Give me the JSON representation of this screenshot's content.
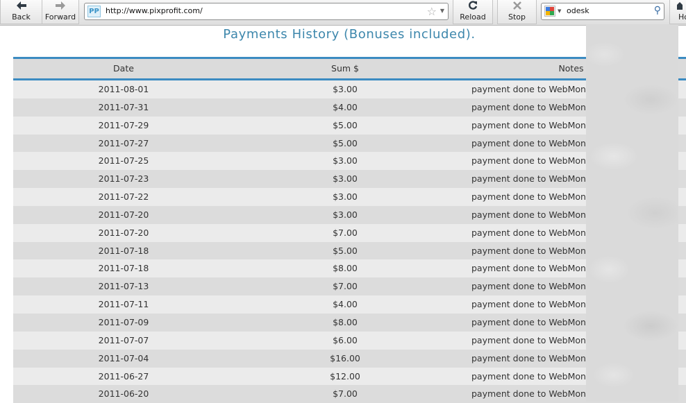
{
  "browser": {
    "back_label": "Back",
    "forward_label": "Forward",
    "reload_label": "Reload",
    "stop_label": "Stop",
    "home_label_partial": "Ho",
    "url": "http://www.pixprofit.com/",
    "site_icon_text": "PP",
    "search_query": "odesk",
    "icons": {
      "back": "arrow-left-icon",
      "forward": "arrow-right-icon",
      "reload": "reload-icon",
      "stop": "stop-x-icon",
      "bookmark": "star-icon",
      "search_engine": "google-icon",
      "search": "magnifier-icon"
    }
  },
  "page": {
    "title": "Payments History (Bonuses included).",
    "accent_color": "#3b8bc1",
    "title_color": "#3d87ac"
  },
  "table": {
    "headers": {
      "date": "Date",
      "sum": "Sum $",
      "notes": "Notes"
    },
    "rows": [
      {
        "date": "2011-08-01",
        "sum": "$3.00",
        "notes": "payment done to WebMoney"
      },
      {
        "date": "2011-07-31",
        "sum": "$4.00",
        "notes": "payment done to WebMoney"
      },
      {
        "date": "2011-07-29",
        "sum": "$5.00",
        "notes": "payment done to WebMoney"
      },
      {
        "date": "2011-07-27",
        "sum": "$5.00",
        "notes": "payment done to WebMoney"
      },
      {
        "date": "2011-07-25",
        "sum": "$3.00",
        "notes": "payment done to WebMoney"
      },
      {
        "date": "2011-07-23",
        "sum": "$3.00",
        "notes": "payment done to WebMoney"
      },
      {
        "date": "2011-07-22",
        "sum": "$3.00",
        "notes": "payment done to WebMoney"
      },
      {
        "date": "2011-07-20",
        "sum": "$3.00",
        "notes": "payment done to WebMoney"
      },
      {
        "date": "2011-07-20",
        "sum": "$7.00",
        "notes": "payment done to WebMoney"
      },
      {
        "date": "2011-07-18",
        "sum": "$5.00",
        "notes": "payment done to WebMoney"
      },
      {
        "date": "2011-07-18",
        "sum": "$8.00",
        "notes": "payment done to WebMoney"
      },
      {
        "date": "2011-07-13",
        "sum": "$7.00",
        "notes": "payment done to WebMoney"
      },
      {
        "date": "2011-07-11",
        "sum": "$4.00",
        "notes": "payment done to WebMoney"
      },
      {
        "date": "2011-07-09",
        "sum": "$8.00",
        "notes": "payment done to WebMoney"
      },
      {
        "date": "2011-07-07",
        "sum": "$6.00",
        "notes": "payment done to WebMoney"
      },
      {
        "date": "2011-07-04",
        "sum": "$16.00",
        "notes": "payment done to WebMoney"
      },
      {
        "date": "2011-06-27",
        "sum": "$12.00",
        "notes": "payment done to WebMoney"
      },
      {
        "date": "2011-06-20",
        "sum": "$7.00",
        "notes": "payment done to WebMoney"
      }
    ]
  }
}
